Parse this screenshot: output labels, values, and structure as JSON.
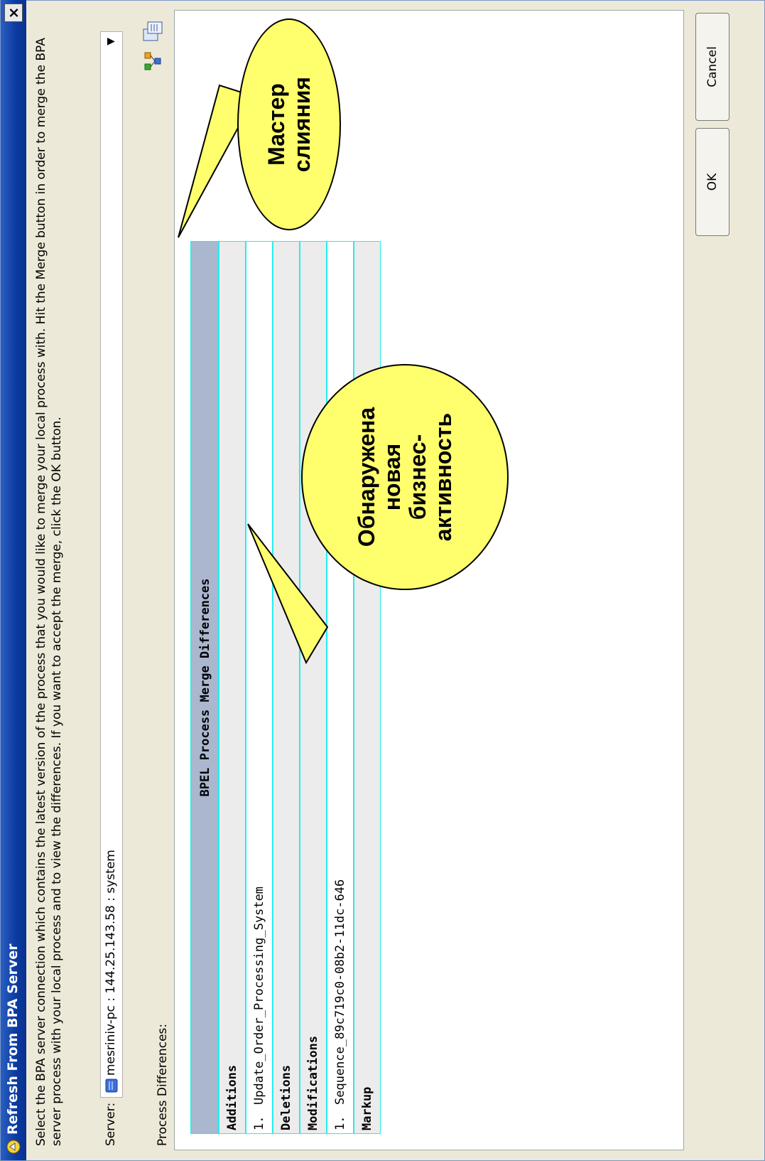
{
  "window": {
    "title": "Refresh From BPA Server",
    "close_glyph": "×"
  },
  "instructions": "Select the BPA server connection which contains the latest version of the process that you would like to merge your local process with. Hit the Merge button in order to merge the BPA server process with your local process and to view the differences. If you want to accept the merge, click the OK button.",
  "server": {
    "label": "Server:",
    "value": "mesriniv-pc : 144.25.143.58 : system"
  },
  "differences": {
    "label": "Process Differences:",
    "table_title": "BPEL Process Merge Differences",
    "sections": {
      "additions": "Additions",
      "deletions": "Deletions",
      "modifications": "Modifications",
      "markup": "Markup"
    },
    "addition_items": [
      {
        "num": "1.",
        "text": "Update_Order_Processing_System"
      }
    ],
    "modification_items": [
      {
        "num": "1.",
        "text": "Sequence_89c719c0-08b2-11dc-646"
      }
    ]
  },
  "buttons": {
    "ok": "OK",
    "cancel": "Cancel"
  },
  "icons": {
    "title": "app-icon",
    "merge": "merge-wizard-icon",
    "view": "view-differences-icon",
    "server": "server-icon"
  },
  "callouts": {
    "merge_wizard": [
      "Мастер",
      "слияния"
    ],
    "new_activity": [
      "Обнаружена",
      "новая",
      "бизнес-",
      "активность"
    ]
  },
  "colors": {
    "titlebar": "#0b3aa0",
    "bubble": "#ffff6e",
    "table_border": "#22eeee",
    "table_header": "#aab7cf"
  }
}
